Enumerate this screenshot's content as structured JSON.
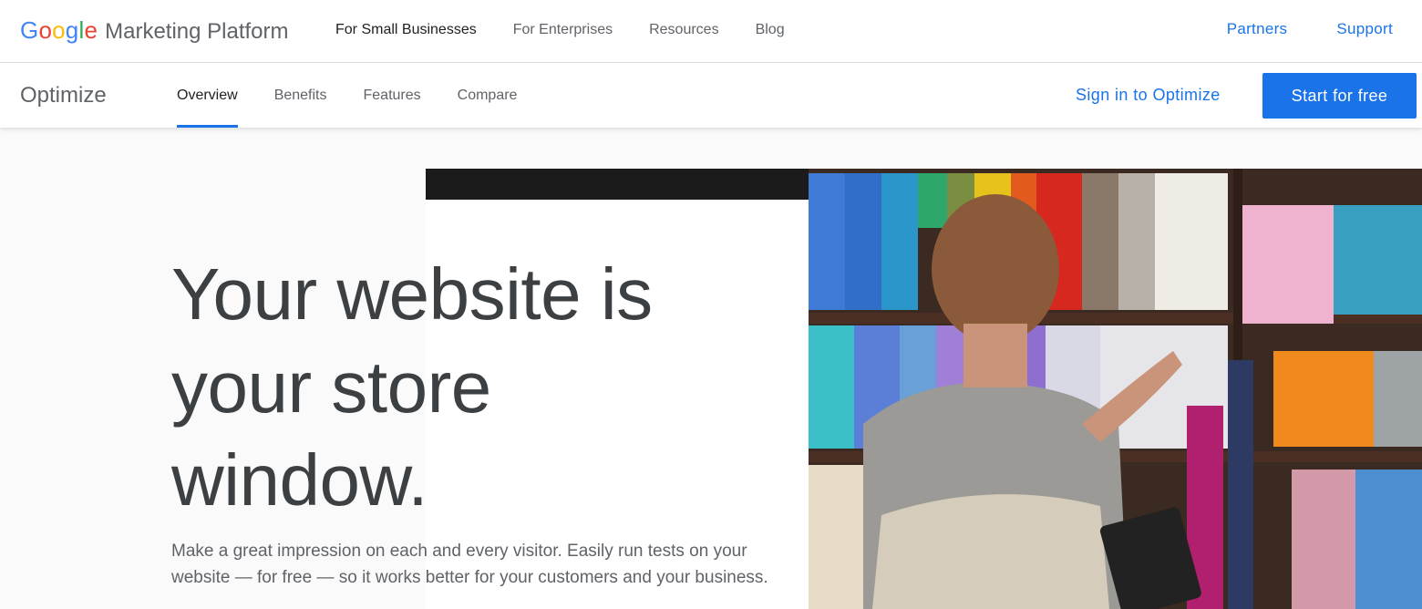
{
  "brand": {
    "google_letters": [
      {
        "ch": "G",
        "color": "#4285F4"
      },
      {
        "ch": "o",
        "color": "#EA4335"
      },
      {
        "ch": "o",
        "color": "#FBBC05"
      },
      {
        "ch": "g",
        "color": "#4285F4"
      },
      {
        "ch": "l",
        "color": "#34A853"
      },
      {
        "ch": "e",
        "color": "#EA4335"
      }
    ],
    "rest": "Marketing Platform"
  },
  "topnav": {
    "items": [
      "For Small Businesses",
      "For Enterprises",
      "Resources",
      "Blog"
    ],
    "active_index": 0
  },
  "topright": {
    "partners": "Partners",
    "support": "Support"
  },
  "product": {
    "name": "Optimize"
  },
  "subnav": {
    "tabs": [
      "Overview",
      "Benefits",
      "Features",
      "Compare"
    ],
    "active_index": 0
  },
  "actions": {
    "signin": "Sign in to Optimize",
    "cta": "Start for free"
  },
  "hero": {
    "headline": "Your website is your store window.",
    "lede": "Make a great impression on each and every visitor. Easily run tests on your website — for free — so it works better for your customers and your business.",
    "photo": "woman-browsing-yarn-shelves-photo"
  },
  "colors": {
    "accent": "#1a73e8",
    "text_primary": "#202124",
    "text_muted": "#5f6368"
  }
}
